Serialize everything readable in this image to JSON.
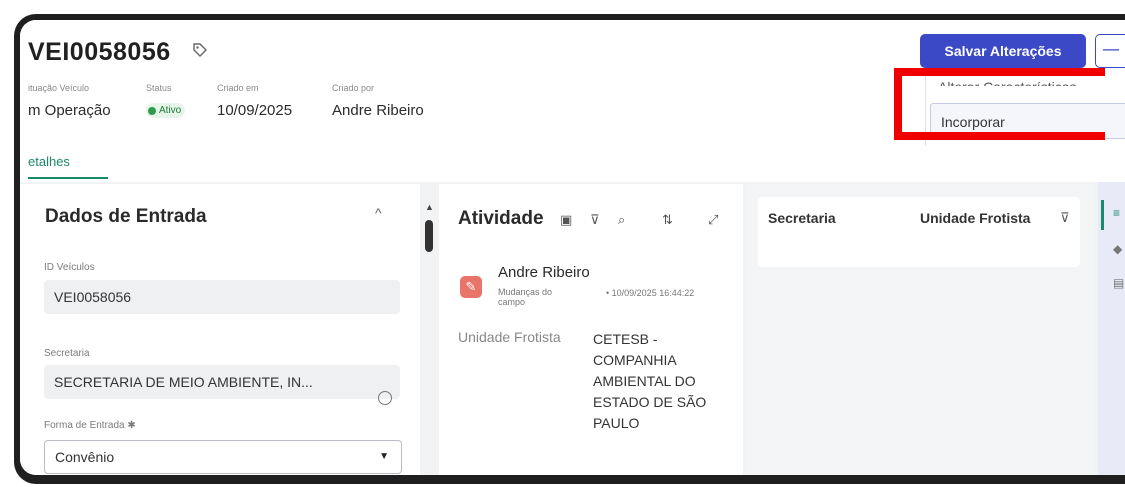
{
  "record": {
    "title": "VEI0058056",
    "situacao_label": "ituação Veículo",
    "situacao_value": "m Operação",
    "status_label": "Status",
    "status_value": "Ativo",
    "criado_em_label": "Criado em",
    "criado_em_value": "10/09/2025",
    "criado_por_label": "Criado por",
    "criado_por_value": "Andre Ribeiro"
  },
  "tabs": {
    "details": "etalhes"
  },
  "toolbar": {
    "save_label": "Salvar Alterações",
    "more_label": "—",
    "menu_cut_item": "Alterar Características",
    "menu_incorporar": "Incorporar"
  },
  "dados_entrada": {
    "title": "Dados de Entrada",
    "id_label": "ID Veículos",
    "id_value": "VEI0058056",
    "secretaria_label": "Secretaria",
    "secretaria_value": "SECRETARIA DE MEIO AMBIENTE, IN...",
    "forma_label": "Forma de Entrada ✱",
    "forma_value": "Convênio"
  },
  "atividade": {
    "title": "Atividade",
    "author": "Andre Ribeiro",
    "sub": "Mudanças do campo",
    "date": "• 10/09/2025 16:44:22",
    "field_label": "Unidade Frotista",
    "field_value": "CETESB - COMPANHIA AMBIENTAL DO ESTADO DE SÃO PAULO"
  },
  "grid": {
    "col1": "Secretaria",
    "col2": "Unidade Frotista"
  },
  "icons": [
    "tag-icon",
    "collapse-icon",
    "filter-icon",
    "search-icon",
    "sort-icon",
    "expand-icon",
    "edit-icon",
    "info-icon",
    "chevron-down-icon"
  ],
  "colors": {
    "primary": "#3b49c6",
    "accent": "#1a8a6c",
    "highlight": "#f10000",
    "status_green": "#2e9d4a"
  }
}
